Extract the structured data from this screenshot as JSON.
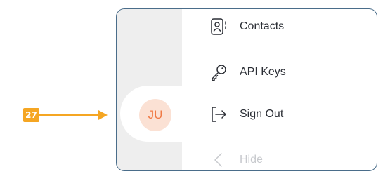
{
  "callout": {
    "number": "27",
    "color": "#f5a623"
  },
  "avatar": {
    "initials": "JU",
    "background_color": "#fbe1d4",
    "text_color": "#f07a45"
  },
  "menu": {
    "items": [
      {
        "label": "Contacts",
        "icon": "contacts-icon"
      },
      {
        "label": "API Keys",
        "icon": "key-icon"
      },
      {
        "label": "Sign Out",
        "icon": "sign-out-icon"
      },
      {
        "label": "Hide",
        "icon": "chevron-left-icon",
        "state": "muted"
      }
    ]
  },
  "panel": {
    "border_color": "#4a6d8a",
    "sidebar_color": "#eeeeee"
  }
}
